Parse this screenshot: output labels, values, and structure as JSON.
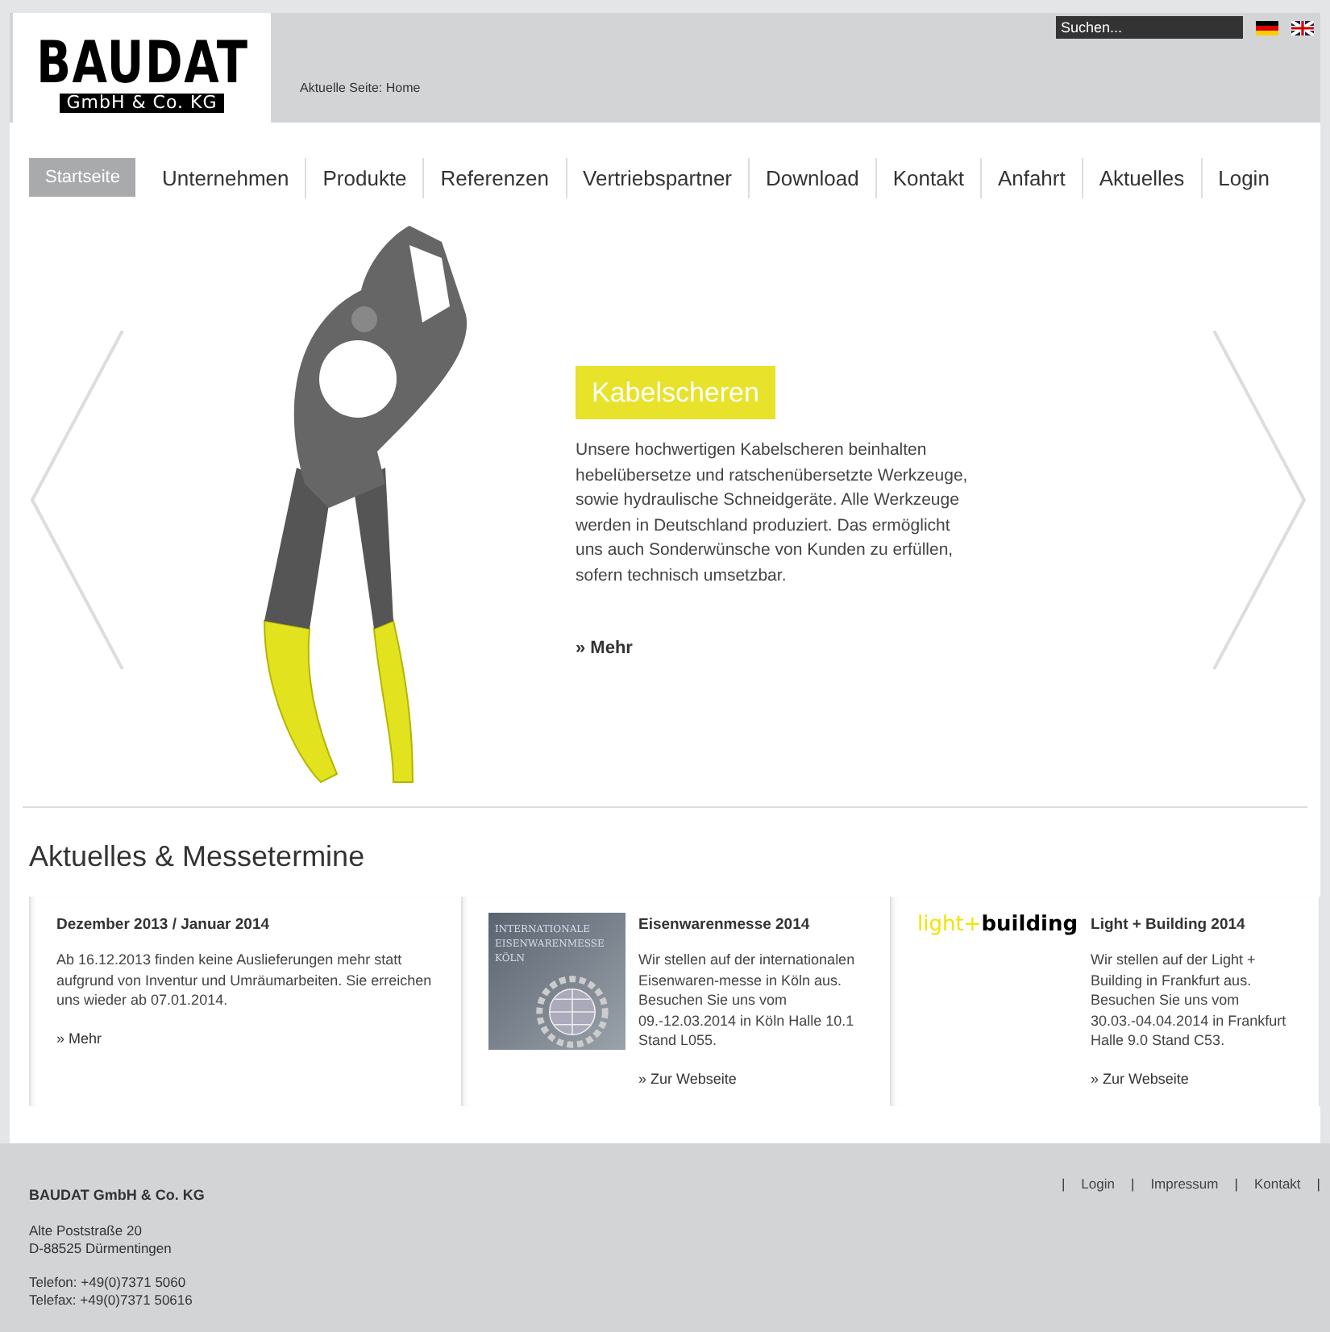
{
  "header": {
    "logo": {
      "name": "BAUDAT",
      "subtitle": "GmbH & Co. KG"
    },
    "breadcrumb": "Aktuelle Seite: Home",
    "search": {
      "placeholder": "Suchen..."
    },
    "languages": [
      {
        "kind": "de"
      },
      {
        "kind": "en"
      }
    ]
  },
  "nav": {
    "items": [
      {
        "label": "Startseite",
        "selected": true
      },
      {
        "label": "Unternehmen",
        "selected": false
      },
      {
        "label": "Produkte",
        "selected": false
      },
      {
        "label": "Referenzen",
        "selected": false
      },
      {
        "label": "Vertriebspartner",
        "selected": false
      },
      {
        "label": "Download",
        "selected": false
      },
      {
        "label": "Kontakt",
        "selected": false
      },
      {
        "label": "Anfahrt",
        "selected": false
      },
      {
        "label": "Aktuelles",
        "selected": false
      },
      {
        "label": "Login",
        "selected": false
      }
    ]
  },
  "hero": {
    "title": "Kabelscheren",
    "text": "Unsere hochwertigen Kabelscheren beinhalten hebelübersetze und ratschenübersetzte Werkzeuge, sowie hydraulische Schneidgeräte. Alle Werkzeuge werden in Deutschland produziert. Das ermöglicht uns auch Sonderwünsche von Kunden zu erfüllen, sofern technisch umsetzbar.",
    "link": "» Mehr"
  },
  "news": {
    "heading": "Aktuelles & Messetermine",
    "items": [
      {
        "kind": "text",
        "title": "Dezember 2013 / Januar 2014",
        "text": "Ab 16.12.2013 finden keine Auslieferungen mehr statt aufgrund von Inventur und Umräumarbeiten. Sie erreichen uns wieder ab 07.01.2014.",
        "link": "» Mehr"
      },
      {
        "kind": "messe",
        "logo": [
          "INTERNATIONALE",
          "EISENWARENMESSE",
          "KÖLN"
        ],
        "title": "Eisenwarenmesse 2014",
        "text": "Wir stellen auf der internationalen Eisenwaren-messe in Köln aus. Besuchen Sie uns vom 09.-12.03.2014 in Köln Halle 10.1 Stand L055.",
        "link": "» Zur Webseite"
      },
      {
        "kind": "wordmark",
        "logo": {
          "accent": "light+",
          "main": "building"
        },
        "title": "Light + Building 2014",
        "text": "Wir stellen auf der Light + Building in Frankfurt aus. Besuchen Sie uns vom 30.03.-04.04.2014 in Frankfurt Halle 9.0 Stand C53.",
        "link": "» Zur Webseite"
      }
    ]
  },
  "footer": {
    "company": "BAUDAT GmbH & Co. KG",
    "address": [
      "Alte Poststraße 20",
      "D-88525 Dürmentingen"
    ],
    "contact": [
      "Telefon: +49(0)7371 5060",
      "Telefax: +49(0)7371 50616"
    ],
    "links": [
      "Login",
      "Impressum",
      "Kontakt"
    ],
    "separator": "|"
  }
}
